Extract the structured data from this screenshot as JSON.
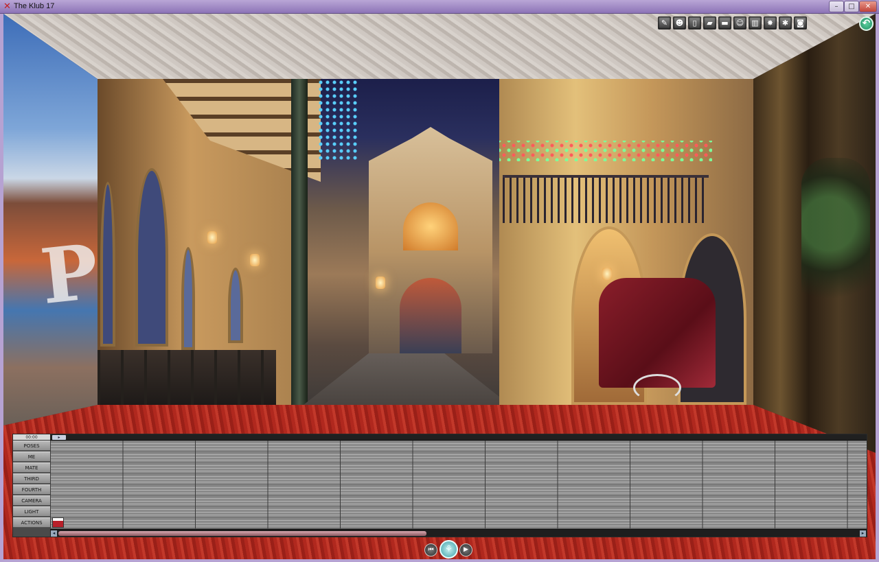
{
  "window": {
    "title": "The Klub 17",
    "icon": "app-x-icon",
    "controls": [
      "minimize",
      "maximize",
      "close"
    ]
  },
  "toolbar": {
    "buttons": [
      {
        "icon": "camera-icon",
        "glyph": "✎"
      },
      {
        "icon": "figure-icon",
        "glyph": "☻"
      },
      {
        "icon": "page-icon",
        "glyph": "▯"
      },
      {
        "icon": "folder-icon",
        "glyph": "▰"
      },
      {
        "icon": "screen-icon",
        "glyph": "▬"
      },
      {
        "icon": "portrait-icon",
        "glyph": "☺"
      },
      {
        "icon": "chart-icon",
        "glyph": "▥"
      },
      {
        "icon": "film-icon",
        "glyph": "✸"
      },
      {
        "icon": "pose-icon",
        "glyph": "✱"
      },
      {
        "icon": "movie-camera-icon",
        "glyph": "◙"
      }
    ],
    "back_glyph": "↶"
  },
  "timeline": {
    "time": "00:00",
    "marker": "▸",
    "tracks": [
      "POSES",
      "ME",
      "MATE",
      "THIRD",
      "FOURTH",
      "CAMERA",
      "LIGHT",
      "ACTIONS"
    ],
    "scroll_position": 0.46
  },
  "transport": {
    "rewind_glyph": "⏮",
    "record_glyph": "⚘",
    "play_glyph": "▶"
  },
  "colors": {
    "titlebar": "#a08ec4",
    "floor": "#b0281e",
    "timeline_grid": "#8a8a8a"
  }
}
